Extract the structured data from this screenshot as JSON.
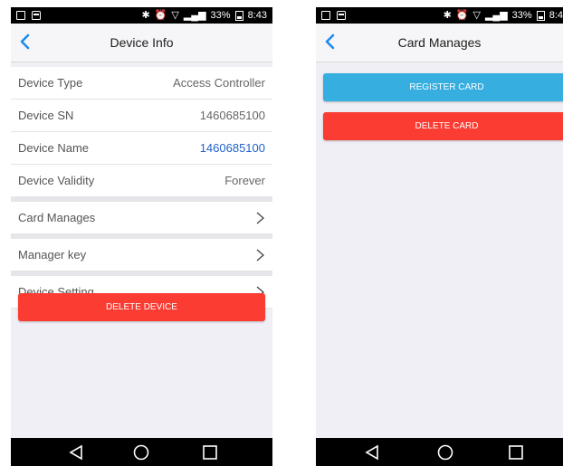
{
  "status_bar": {
    "battery": "33%",
    "time_left": "8:43",
    "time_right": "8:4",
    "signal": "•••l"
  },
  "left_screen": {
    "title": "Device Info",
    "info_rows": [
      {
        "label": "Device Type",
        "value": "Access Controller"
      },
      {
        "label": "Device SN",
        "value": "1460685100"
      },
      {
        "label": "Device Name",
        "value": "1460685100"
      },
      {
        "label": "Device Validity",
        "value": "Forever"
      }
    ],
    "nav_rows": [
      {
        "label": "Card Manages"
      },
      {
        "label": "Manager key"
      },
      {
        "label": "Device Setting"
      }
    ],
    "delete_button": "DELETE DEVICE"
  },
  "right_screen": {
    "title": "Card Manages",
    "register_button": "REGISTER CARD",
    "delete_button": "DELETE CARD"
  },
  "colors": {
    "accent_blue": "#1a8cf0",
    "link_blue": "#1f62c9",
    "danger_red": "#fa3c32",
    "register_blue": "#36aee0"
  },
  "icons": {
    "back": "chevron-left-icon",
    "row_arrow": "chevron-right-icon",
    "sys_back": "triangle-back-icon",
    "sys_home": "circle-home-icon",
    "sys_recent": "square-recent-icon"
  }
}
